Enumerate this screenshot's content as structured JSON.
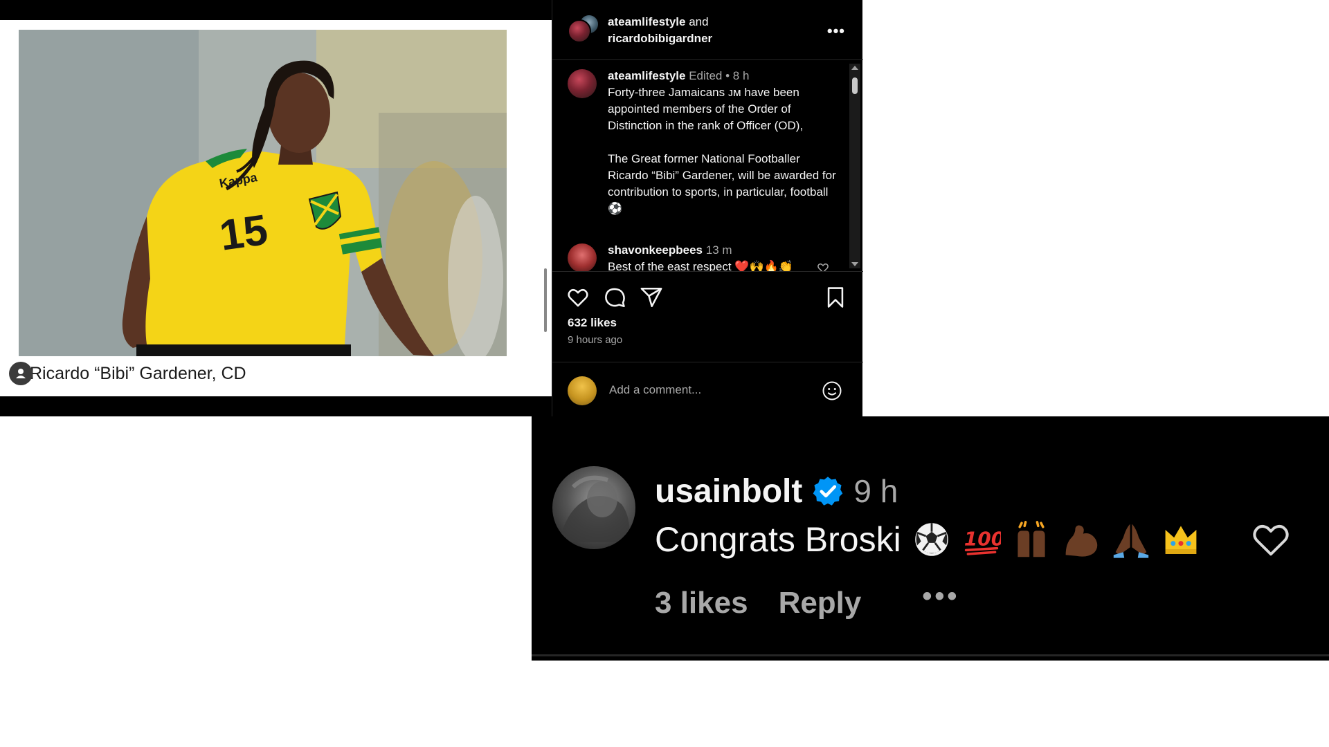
{
  "photo": {
    "jersey_brand": "Kappa",
    "jersey_number": "15",
    "caption": "Ricardo “Bibi” Gardener, CD"
  },
  "post": {
    "header": {
      "user1": "ateamlifestyle",
      "and_text": "and",
      "user2": "ricardobibigardner",
      "more_label": "•••"
    },
    "caption_comment": {
      "username": "ateamlifestyle",
      "meta": "Edited • 8 h",
      "text": "Forty-three Jamaicans ᴊᴍ have been appointed members of the Order of Distinction in the rank of Officer (OD),\n\nThe Great former National Footballer Ricardo “Bibi” Gardener, will be awarded for contribution to sports, in particular, football ⚽"
    },
    "comments": [
      {
        "username": "shavonkeepbees",
        "meta": "13 m",
        "text": "Best of the east respect ❤️🙌🔥👏"
      }
    ],
    "likes": "632 likes",
    "time_ago": "9 hours ago",
    "comment_input": {
      "placeholder": "Add a comment..."
    },
    "icons": [
      "heart-icon",
      "comment-icon",
      "share-icon",
      "bookmark-icon",
      "emoji-icon"
    ]
  },
  "bolt_comment": {
    "username": "usainbolt",
    "time": "9 h",
    "text": "Congrats Broski",
    "emojis": [
      "⚽",
      "💯",
      "🙌🏿",
      "💪🏿",
      "🙏🏿",
      "👑"
    ],
    "likes": "3 likes",
    "reply": "Reply",
    "more": "•••"
  },
  "colors": {
    "background_dark": "#000000",
    "text_primary": "#f5f5f5",
    "text_secondary": "#a8a8a8",
    "verified_blue": "#0095f6",
    "jersey_yellow": "#f4d417"
  }
}
